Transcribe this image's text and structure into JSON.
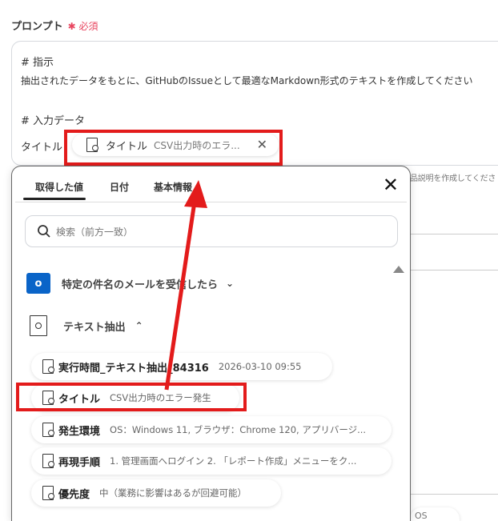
{
  "field": {
    "label": "プロンプト",
    "required": "✱ 必須"
  },
  "prompt": {
    "line1": "# 指示",
    "line2": "抽出されたデータをもとに、GitHubのIssueとして最適なMarkdown形式のテキストを作成してください",
    "line3": "# 入力データ",
    "line4": "タイトル：",
    "chip_label": "タイトル",
    "chip_value": "CSV出力時のエラ..."
  },
  "background": {
    "text": "品説明を作成してくださ",
    "pill": "OS"
  },
  "panel": {
    "tabs": [
      "取得した値",
      "日付",
      "基本情報"
    ],
    "search_placeholder": "検索（前方一致）",
    "groups": [
      {
        "label": "特定の件名のメールを受信したら"
      },
      {
        "label": "テキスト抽出"
      }
    ],
    "items": [
      {
        "label": "実行時間_テキスト抽出_84316",
        "value": "2026-03-10 09:55"
      },
      {
        "label": "タイトル",
        "value": "CSV出力時のエラー発生"
      },
      {
        "label": "発生環境",
        "value": "OS：Windows 11, ブラウザ：Chrome 120, アプリバージ..."
      },
      {
        "label": "再現手順",
        "value": "1. 管理画面へログイン 2. 「レポート作成」メニューをク..."
      },
      {
        "label": "優先度",
        "value": "中（業務に影響はあるが回避可能）"
      }
    ]
  },
  "colors": {
    "annotation": "#e31b1b",
    "required": "#e8455f"
  }
}
